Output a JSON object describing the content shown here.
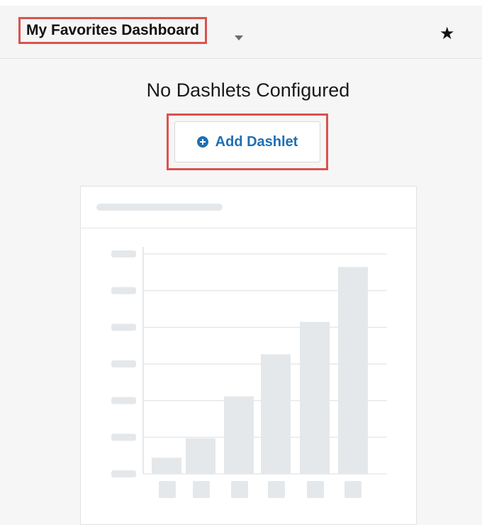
{
  "header": {
    "dashboard_title": "My Favorites Dashboard",
    "dropdown_icon": "caret-down-icon",
    "favorite_icon": "star-icon"
  },
  "main": {
    "empty_message": "No Dashlets Configured",
    "add_button": {
      "label": "Add Dashlet",
      "icon": "plus-circle-icon"
    }
  },
  "colors": {
    "highlight": "#d9534f",
    "accent": "#1f6fb2",
    "placeholder": "#e5e8ea"
  },
  "placeholder_chart": {
    "bars": [
      5,
      11,
      24,
      37,
      47,
      64
    ],
    "max": 68,
    "gridlines": 7
  }
}
